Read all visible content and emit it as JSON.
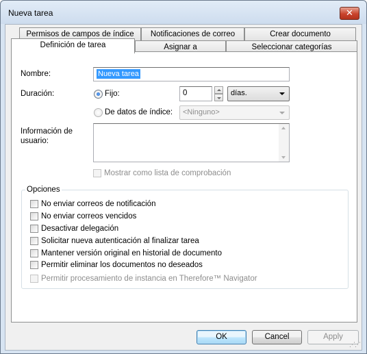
{
  "window": {
    "title": "Nueva tarea",
    "close_glyph": "✕"
  },
  "tabs": {
    "row_back": [
      "Permisos de campos de índice",
      "Notificaciones de correo",
      "Crear documento"
    ],
    "row_front": [
      "Definición de tarea",
      "Asignar a",
      "Seleccionar categorías"
    ]
  },
  "form": {
    "name_label": "Nombre:",
    "name_value": "Nueva tarea",
    "duration_label": "Duración:",
    "fixed_label": "Fijo:",
    "fixed_value": "0",
    "unit_value": "días.",
    "index_label": "De datos de índice:",
    "index_value": "<Ninguno>",
    "user_info_label": "Información de usuario:",
    "user_info_value": "",
    "checklist_label": "Mostrar como lista de comprobación"
  },
  "options": {
    "title": "Opciones",
    "items": [
      {
        "label": "No enviar correos de notificación",
        "checked": false,
        "enabled": true
      },
      {
        "label": "No enviar correos vencidos",
        "checked": false,
        "enabled": true
      },
      {
        "label": "Desactivar delegación",
        "checked": false,
        "enabled": true
      },
      {
        "label": "Solicitar nueva autenticación al finalizar tarea",
        "checked": false,
        "enabled": true
      },
      {
        "label": "Mantener versión original en historial de documento",
        "checked": false,
        "enabled": true
      },
      {
        "label": "Permitir eliminar los documentos no deseados",
        "checked": false,
        "enabled": true
      },
      {
        "label": "Permitir procesamiento de instancia en Therefore™ Navigator",
        "checked": false,
        "enabled": false
      }
    ]
  },
  "buttons": {
    "ok": "OK",
    "cancel": "Cancel",
    "apply": "Apply"
  }
}
